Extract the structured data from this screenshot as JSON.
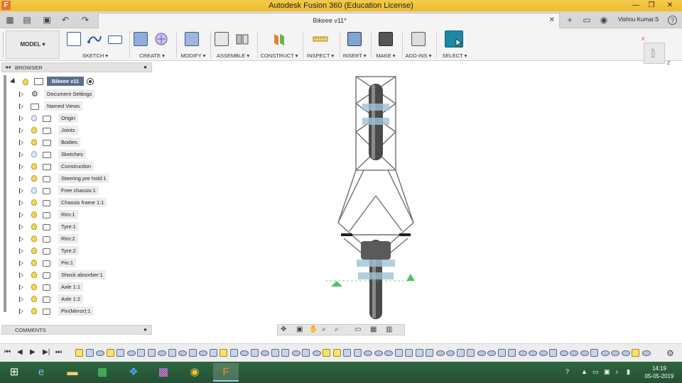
{
  "window": {
    "title": "Autodesk Fusion 360 (Education License)",
    "app_icon_letter": "F",
    "minimize": "—",
    "maximize": "❐",
    "close": "✕"
  },
  "tabbar": {
    "doc_title": "Bikeee v11*",
    "close_glyph": "✕",
    "user": "Vishnu Kumar.S",
    "help": "?"
  },
  "ribbon": {
    "workspace": "MODEL ▾",
    "groups": [
      {
        "label": "SKETCH ▾"
      },
      {
        "label": "CREATE ▾"
      },
      {
        "label": "MODIFY ▾"
      },
      {
        "label": "ASSEMBLE ▾"
      },
      {
        "label": "CONSTRUCT ▾"
      },
      {
        "label": "INSPECT ▾"
      },
      {
        "label": "INSERT ▾"
      },
      {
        "label": "MAKE ▾"
      },
      {
        "label": "ADD-INS ▾"
      },
      {
        "label": "SELECT ▾"
      }
    ],
    "accent": "#1a8aa6"
  },
  "viewcube": {
    "face": "TOP",
    "x_axis": "X",
    "z_axis": "Z"
  },
  "browser": {
    "header": "BROWSER",
    "collapse_glyph": "◂◂",
    "root": "Bikeee v11",
    "items": [
      {
        "label": "Document Settings",
        "kind": "gear"
      },
      {
        "label": "Named Views",
        "kind": "docfolder"
      },
      {
        "label": "Origin",
        "kind": "folder",
        "visible": false
      },
      {
        "label": "Joints",
        "kind": "folder",
        "visible": true
      },
      {
        "label": "Bodies",
        "kind": "folder",
        "visible": true
      },
      {
        "label": "Sketches",
        "kind": "folder",
        "visible": false
      },
      {
        "label": "Construction",
        "kind": "folder",
        "visible": true
      },
      {
        "label": "Steering pre hold:1",
        "kind": "component",
        "visible": true
      },
      {
        "label": "Free chassis:1",
        "kind": "component",
        "visible": false
      },
      {
        "label": "Chassis frame 1:1",
        "kind": "component",
        "visible": true
      },
      {
        "label": "Rim:1",
        "kind": "component",
        "visible": true
      },
      {
        "label": "Tyre:1",
        "kind": "component",
        "visible": true
      },
      {
        "label": "Rim:2",
        "kind": "component",
        "visible": true
      },
      {
        "label": "Tyre:2",
        "kind": "component",
        "visible": true
      },
      {
        "label": "Pin:1",
        "kind": "component",
        "visible": true
      },
      {
        "label": "Shock absorber:1",
        "kind": "component",
        "visible": true
      },
      {
        "label": "Axle 1:1",
        "kind": "component",
        "visible": true
      },
      {
        "label": "Axle 1:2",
        "kind": "component",
        "visible": true
      },
      {
        "label": "Pin(Mirror):1",
        "kind": "component",
        "visible": true
      }
    ]
  },
  "comments": {
    "header": "COMMENTS"
  },
  "taskbar": {
    "time": "14:19",
    "date": "05-05-2019"
  },
  "timeline": {
    "features": [
      "s",
      "f",
      "b",
      "s",
      "f",
      "b",
      "f",
      "f",
      "b",
      "f",
      "b",
      "f",
      "b",
      "f",
      "s",
      "f",
      "b",
      "f",
      "b",
      "f",
      "f",
      "b",
      "f",
      "b",
      "s",
      "s",
      "f",
      "f",
      "b",
      "b",
      "b",
      "f",
      "f",
      "f",
      "f",
      "b",
      "b",
      "f",
      "f",
      "b",
      "b",
      "f",
      "f",
      "b",
      "b",
      "b",
      "f",
      "b",
      "b",
      "b",
      "f",
      "b",
      "b",
      "b",
      "s",
      "b"
    ]
  }
}
